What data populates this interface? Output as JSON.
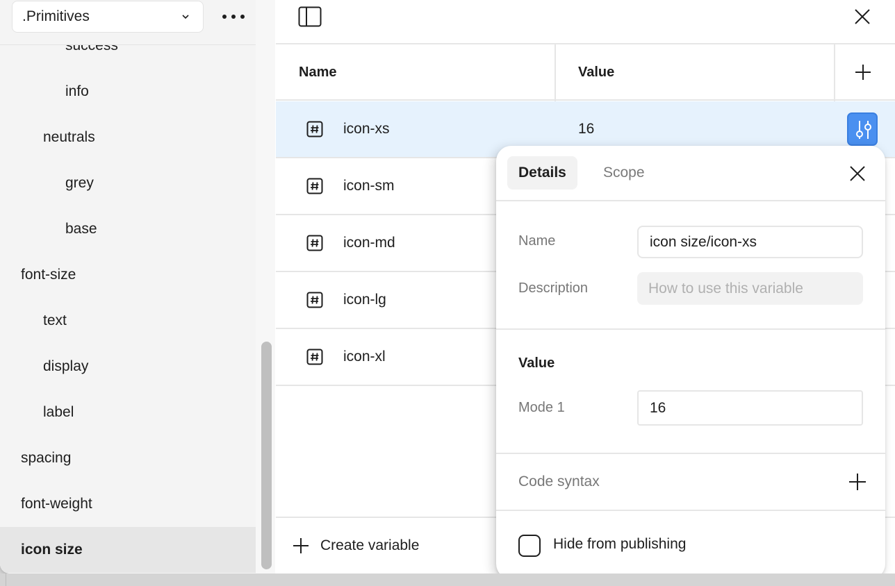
{
  "sidebar": {
    "collection": ".Primitives",
    "items": [
      {
        "label": "success",
        "level": 2
      },
      {
        "label": "info",
        "level": 2
      },
      {
        "label": "neutrals",
        "level": 1
      },
      {
        "label": "grey",
        "level": 2
      },
      {
        "label": "base",
        "level": 2
      },
      {
        "label": "font-size",
        "level": 0
      },
      {
        "label": "text",
        "level": 1
      },
      {
        "label": "display",
        "level": 1
      },
      {
        "label": "label",
        "level": 1
      },
      {
        "label": "spacing",
        "level": 0
      },
      {
        "label": "font-weight",
        "level": 0
      },
      {
        "label": "icon size",
        "level": 0,
        "selected": true
      }
    ]
  },
  "table": {
    "headers": {
      "name": "Name",
      "value": "Value"
    },
    "rows": [
      {
        "name": "icon-xs",
        "value": "16",
        "selected": true
      },
      {
        "name": "icon-sm",
        "value": ""
      },
      {
        "name": "icon-md",
        "value": ""
      },
      {
        "name": "icon-lg",
        "value": ""
      },
      {
        "name": "icon-xl",
        "value": ""
      }
    ],
    "create_label": "Create variable"
  },
  "popover": {
    "tabs": {
      "details": "Details",
      "scope": "Scope"
    },
    "name_label": "Name",
    "name_value": "icon size/icon-xs",
    "description_label": "Description",
    "description_placeholder": "How to use this variable",
    "value_title": "Value",
    "mode_label": "Mode 1",
    "mode_value": "16",
    "code_syntax_label": "Code syntax",
    "hide_label": "Hide from publishing",
    "hide_checked": false
  },
  "colors": {
    "accent": "#4a90f0",
    "selected_row": "#e6f2fd",
    "sidebar_bg": "#f4f4f4"
  }
}
